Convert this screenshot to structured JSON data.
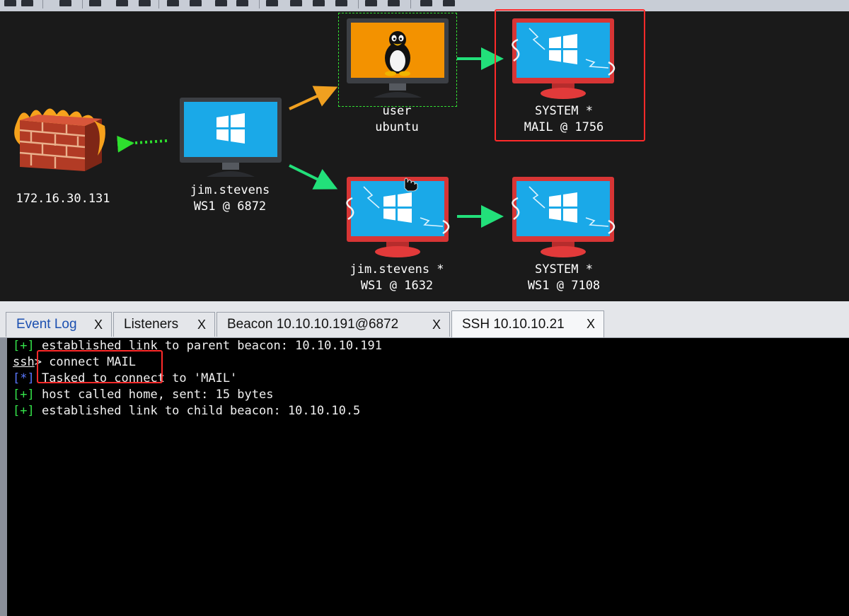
{
  "nodes": {
    "firewall": {
      "line1": "172.16.30.131",
      "icon": "firewall-icon"
    },
    "ws1_root": {
      "line1": "jim.stevens",
      "line2": "WS1 @ 6872",
      "icon": "windows-monitor-icon"
    },
    "ubuntu": {
      "line1": "user",
      "line2": "ubuntu",
      "icon": "linux-monitor-icon"
    },
    "mail": {
      "line1": "SYSTEM *",
      "line2": "MAIL @ 1756",
      "icon": "windows-beacon-monitor-icon"
    },
    "ws1_child": {
      "line1": "jim.stevens *",
      "line2": "WS1 @ 1632",
      "icon": "windows-beacon-monitor-icon"
    },
    "ws1_system": {
      "line1": "SYSTEM *",
      "line2": "WS1 @ 7108",
      "icon": "windows-beacon-monitor-icon"
    }
  },
  "tabs": [
    {
      "label": "Event Log",
      "close": "X"
    },
    {
      "label": "Listeners",
      "close": "X"
    },
    {
      "label": "Beacon 10.10.10.191@6872",
      "close": "X"
    },
    {
      "label": "SSH 10.10.10.21",
      "close": "X"
    }
  ],
  "console": {
    "lines": [
      {
        "tag": "[+]",
        "text": " established link to parent beacon: 10.10.10.191"
      },
      {
        "prompt": "ssh",
        "text": "> connect MAIL"
      },
      {
        "tag": "[*]",
        "text": " Tasked to connect to 'MAIL'"
      },
      {
        "tag": "[+]",
        "text": " host called home, sent: 15 bytes"
      },
      {
        "tag": "[+]",
        "text": " established link to child beacon: 10.10.10.5"
      }
    ]
  },
  "colors": {
    "highlight_box": "#ff2a2a",
    "link_green": "#22e07a",
    "link_orange": "#f0a020",
    "pivot_dotted": "#2ee02e",
    "windows_blue": "#1aa9e8",
    "beacon_red": "#e23a3a",
    "linux_orange": "#f39200"
  }
}
